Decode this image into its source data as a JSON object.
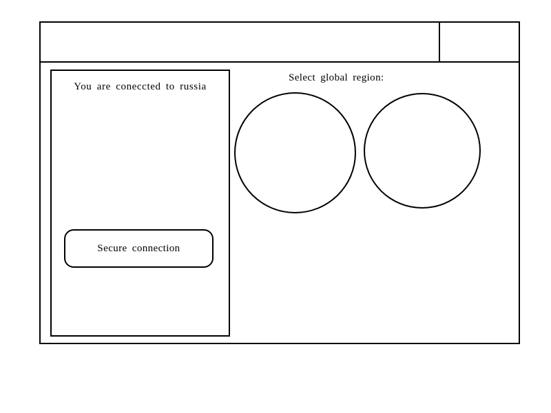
{
  "status": {
    "connected_text": "You are conecct‌ed to russia"
  },
  "actions": {
    "secure_label": "Secure connection"
  },
  "regions": {
    "title": "Select global region:"
  }
}
